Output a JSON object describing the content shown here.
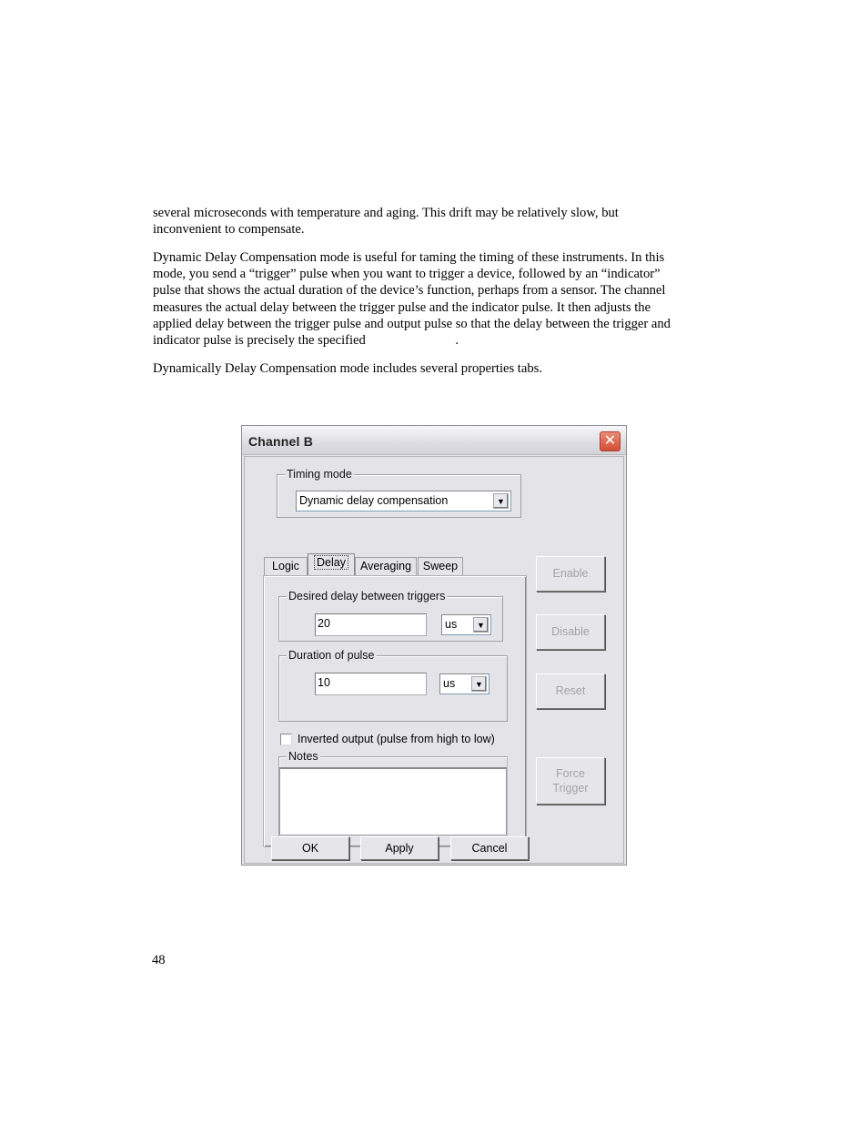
{
  "document": {
    "paragraphs": [
      [
        "several microseconds with temperature and aging. This drift may be relatively slow, but",
        "inconvenient to compensate."
      ],
      [
        "Dynamic Delay Compensation mode is useful for taming the timing of these instruments. In this",
        "mode, you send a “trigger” pulse when you want to trigger a device, followed by an “indicator”",
        "pulse that shows the actual duration of the device’s function, perhaps from a sensor. The channel",
        "measures the actual delay between the trigger pulse and the indicator pulse. It then adjusts the",
        "applied delay between the trigger pulse and output pulse so that the delay between the trigger and",
        "indicator pulse is precisely the specified                           ."
      ],
      [
        "Dynamically Delay Compensation mode includes several properties tabs."
      ]
    ],
    "page_number": "48"
  },
  "dialog": {
    "title": "Channel B",
    "close_icon": "close-icon",
    "timing_mode": {
      "label": "Timing mode",
      "selected": "Dynamic delay compensation",
      "arrow_glyph": "▼"
    },
    "tabs": [
      {
        "label": "Logic",
        "active": false
      },
      {
        "label": "Delay",
        "active": true
      },
      {
        "label": "Averaging",
        "active": false
      },
      {
        "label": "Sweep",
        "active": false
      }
    ],
    "delay_group": {
      "label": "Desired delay between triggers",
      "value": "20",
      "unit": "us"
    },
    "duration_group": {
      "label": "Duration of pulse",
      "value": "10",
      "unit": "us"
    },
    "inverted_output": {
      "label": "Inverted output (pulse from high to low)",
      "checked": false
    },
    "notes": {
      "label": "Notes",
      "value": ""
    },
    "side_buttons": {
      "enable": "Enable",
      "disable": "Disable",
      "reset": "Reset",
      "force_trigger_line1": "Force",
      "force_trigger_line2": "Trigger"
    },
    "footer_buttons": {
      "ok": "OK",
      "apply": "Apply",
      "cancel": "Cancel"
    },
    "close_glyph": "✕"
  }
}
